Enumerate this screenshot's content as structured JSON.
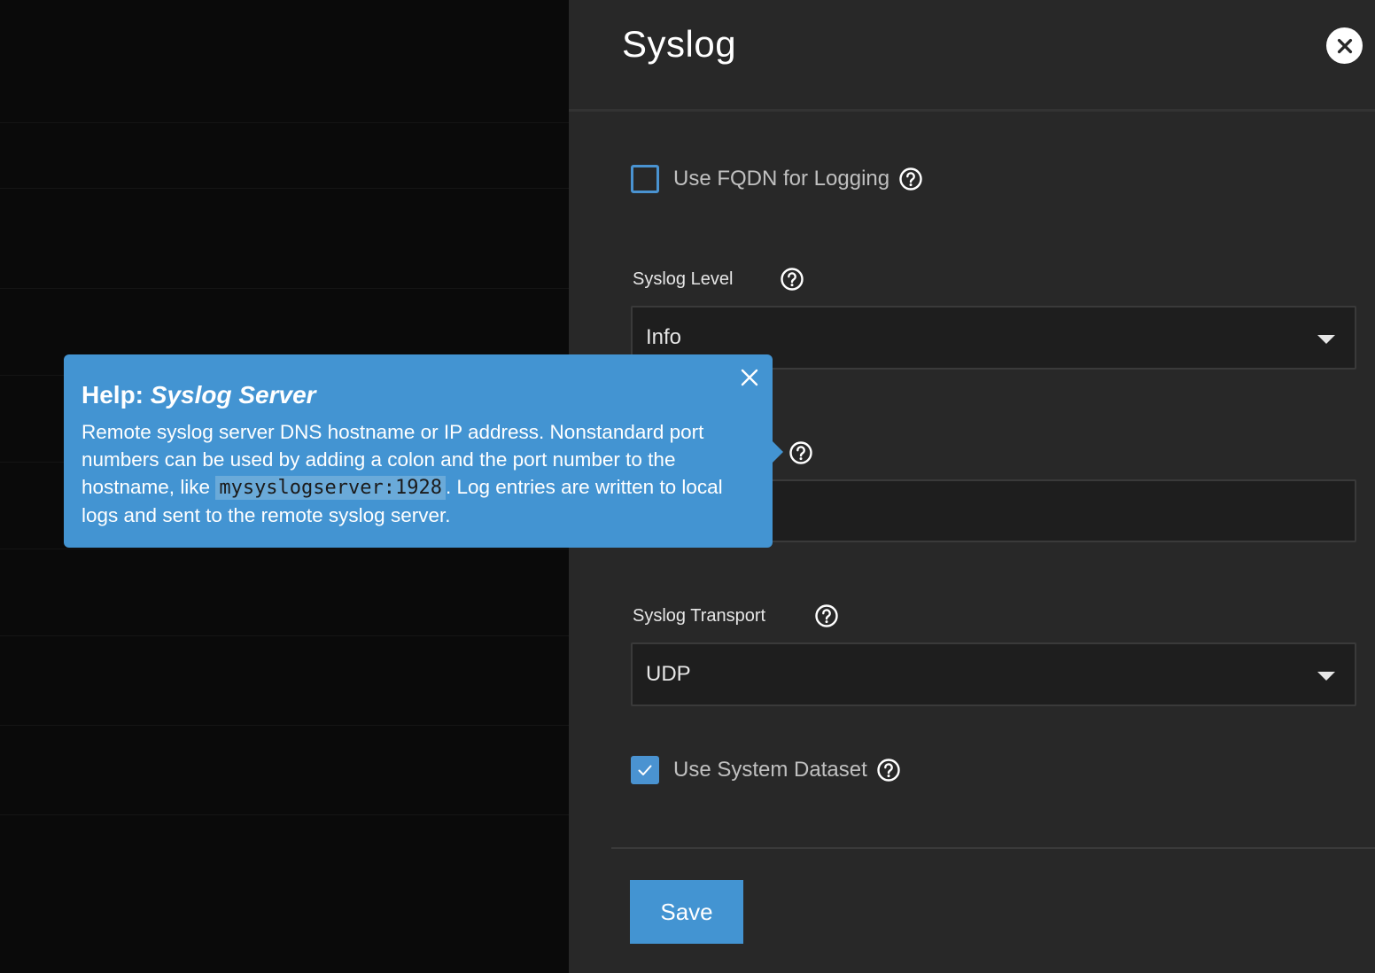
{
  "panel": {
    "title": "Syslog"
  },
  "fields": {
    "use_fqdn": {
      "label": "Use FQDN for Logging",
      "checked": false
    },
    "syslog_level": {
      "label": "Syslog Level",
      "value": "Info"
    },
    "syslog_server": {
      "value": ""
    },
    "syslog_transport": {
      "label": "Syslog Transport",
      "value": "UDP"
    },
    "use_system_dataset": {
      "label": "Use System Dataset",
      "checked": true
    }
  },
  "actions": {
    "save_label": "Save"
  },
  "tooltip": {
    "title_prefix": "Help: ",
    "title_field": "Syslog Server",
    "body_part1": "Remote syslog server DNS hostname or IP address. Nonstandard port numbers can be used by adding a colon and the port number to the hostname, like ",
    "body_code": "mysyslogserver:1928",
    "body_part2": ". Log entries are written to local logs and sent to the remote syslog server."
  },
  "colors": {
    "accent": "#4394d2",
    "panel_bg": "#282828",
    "backdrop": "#0a0a0a"
  },
  "icons": {
    "close": "close-icon",
    "help": "help-circle-icon",
    "check": "check-icon",
    "caret": "caret-down-icon"
  }
}
